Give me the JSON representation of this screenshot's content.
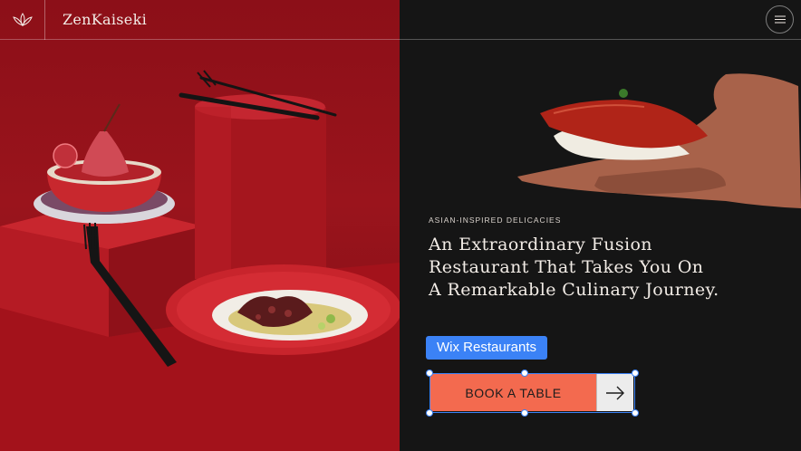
{
  "header": {
    "brand": "ZenKaiseki",
    "logo_icon": "lotus-icon",
    "menu_icon": "hamburger-menu-icon"
  },
  "hero": {
    "eyebrow": "ASIAN-INSPIRED DELICACIES",
    "headline_lines": [
      "An Extraordinary Fusion",
      "Restaurant That Takes You On",
      "A Remarkable Culinary Journey."
    ]
  },
  "editor": {
    "selection_label": "Wix Restaurants"
  },
  "cta": {
    "book_label": "BOOK A TABLE",
    "arrow_icon": "arrow-right-icon"
  },
  "colors": {
    "accent_coral": "#f36a4f",
    "selection_blue": "#3b82f6",
    "left_panel_red": "#8c0f18",
    "right_panel_dark": "#151515"
  }
}
